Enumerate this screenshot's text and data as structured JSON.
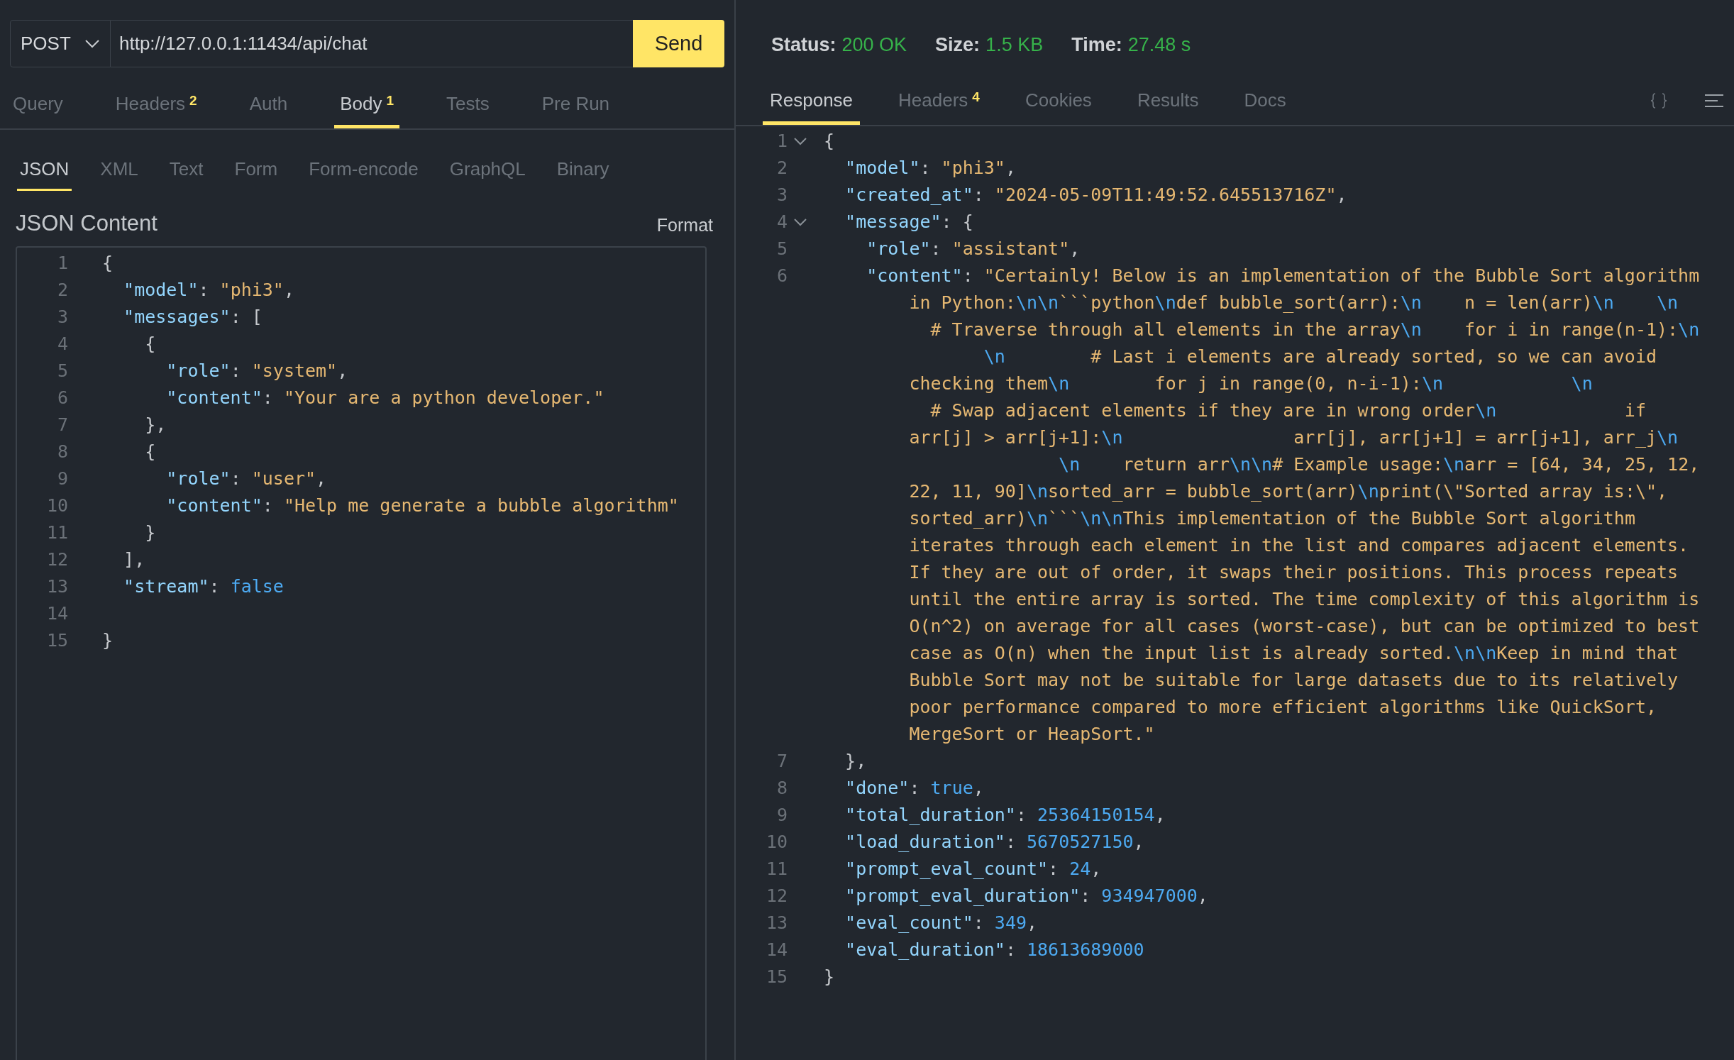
{
  "request": {
    "method": "POST",
    "url": "http://127.0.0.1:11434/api/chat",
    "send_label": "Send",
    "tabs": [
      {
        "label": "Query",
        "selected": false
      },
      {
        "label": "Headers",
        "badge": "2",
        "selected": false
      },
      {
        "label": "Auth",
        "selected": false
      },
      {
        "label": "Body",
        "badge": "1",
        "selected": true
      },
      {
        "label": "Tests",
        "selected": false
      },
      {
        "label": "Pre Run",
        "selected": false
      }
    ],
    "body_tabs": [
      {
        "label": "JSON",
        "selected": true
      },
      {
        "label": "XML",
        "selected": false
      },
      {
        "label": "Text",
        "selected": false
      },
      {
        "label": "Form",
        "selected": false
      },
      {
        "label": "Form-encode",
        "selected": false
      },
      {
        "label": "GraphQL",
        "selected": false
      },
      {
        "label": "Binary",
        "selected": false
      }
    ],
    "section_title": "JSON Content",
    "format_label": "Format",
    "lines": [
      {
        "number": "1",
        "tokens": [
          {
            "kind": "punct",
            "text": "{"
          }
        ]
      },
      {
        "number": "2",
        "tokens": [
          {
            "kind": "key",
            "text": "  \"model\""
          },
          {
            "kind": "punct",
            "text": ": "
          },
          {
            "kind": "str",
            "text": "\"phi3\""
          },
          {
            "kind": "punct",
            "text": ","
          }
        ]
      },
      {
        "number": "3",
        "tokens": [
          {
            "kind": "key",
            "text": "  \"messages\""
          },
          {
            "kind": "punct",
            "text": ": ["
          }
        ]
      },
      {
        "number": "4",
        "tokens": [
          {
            "kind": "punct",
            "text": "    {"
          }
        ]
      },
      {
        "number": "5",
        "tokens": [
          {
            "kind": "key",
            "text": "      \"role\""
          },
          {
            "kind": "punct",
            "text": ": "
          },
          {
            "kind": "str",
            "text": "\"system\""
          },
          {
            "kind": "punct",
            "text": ","
          }
        ]
      },
      {
        "number": "6",
        "tokens": [
          {
            "kind": "key",
            "text": "      \"content\""
          },
          {
            "kind": "punct",
            "text": ": "
          },
          {
            "kind": "str",
            "text": "\"Your are a python developer.\""
          }
        ]
      },
      {
        "number": "7",
        "tokens": [
          {
            "kind": "punct",
            "text": "    },"
          }
        ]
      },
      {
        "number": "8",
        "tokens": [
          {
            "kind": "punct",
            "text": "    {"
          }
        ]
      },
      {
        "number": "9",
        "tokens": [
          {
            "kind": "key",
            "text": "      \"role\""
          },
          {
            "kind": "punct",
            "text": ": "
          },
          {
            "kind": "str",
            "text": "\"user\""
          },
          {
            "kind": "punct",
            "text": ","
          }
        ]
      },
      {
        "number": "10",
        "tokens": [
          {
            "kind": "key",
            "text": "      \"content\""
          },
          {
            "kind": "punct",
            "text": ": "
          },
          {
            "kind": "str",
            "text": "\"Help me generate a bubble algorithm\""
          }
        ]
      },
      {
        "number": "11",
        "tokens": [
          {
            "kind": "punct",
            "text": "    }"
          }
        ]
      },
      {
        "number": "12",
        "tokens": [
          {
            "kind": "punct",
            "text": "  ],"
          }
        ]
      },
      {
        "number": "13",
        "tokens": [
          {
            "kind": "key",
            "text": "  \"stream\""
          },
          {
            "kind": "punct",
            "text": ": "
          },
          {
            "kind": "num",
            "text": "false"
          }
        ]
      },
      {
        "number": "14"
      },
      {
        "number": "15",
        "tokens": [
          {
            "kind": "punct",
            "text": "}"
          }
        ]
      }
    ]
  },
  "response": {
    "status": [
      {
        "label": "Status:",
        "value": "200 OK"
      },
      {
        "label": "Size:",
        "value": "1.5 KB"
      },
      {
        "label": "Time:",
        "value": "27.48 s"
      }
    ],
    "tabs": [
      {
        "label": "Response",
        "selected": true
      },
      {
        "label": "Headers",
        "badge": "4",
        "selected": false
      },
      {
        "label": "Cookies",
        "selected": false
      },
      {
        "label": "Results",
        "selected": false
      },
      {
        "label": "Docs",
        "selected": false
      }
    ],
    "lines": [
      {
        "number": "1",
        "foldable": true,
        "tokens": [
          {
            "kind": "punct",
            "text": "{"
          }
        ]
      },
      {
        "number": "2",
        "foldable": false,
        "tokens": [
          {
            "kind": "key",
            "text": "  \"model\""
          },
          {
            "kind": "punct",
            "text": ": "
          },
          {
            "kind": "str",
            "text": "\"phi3\""
          },
          {
            "kind": "punct",
            "text": ","
          }
        ]
      },
      {
        "number": "3",
        "foldable": false,
        "tokens": [
          {
            "kind": "key",
            "text": "  \"created_at\""
          },
          {
            "kind": "punct",
            "text": ": "
          },
          {
            "kind": "str",
            "text": "\"2024-05-09T11:49:52.645513716Z\""
          },
          {
            "kind": "punct",
            "text": ","
          }
        ]
      },
      {
        "number": "4",
        "foldable": true,
        "tokens": [
          {
            "kind": "key",
            "text": "  \"message\""
          },
          {
            "kind": "punct",
            "text": ": {"
          }
        ]
      },
      {
        "number": "5",
        "foldable": false,
        "tokens": [
          {
            "kind": "key",
            "text": "    \"role\""
          },
          {
            "kind": "punct",
            "text": ": "
          },
          {
            "kind": "str",
            "text": "\"assistant\""
          },
          {
            "kind": "punct",
            "text": ","
          }
        ]
      },
      {
        "number": "6",
        "foldable": false,
        "tokens": [
          {
            "kind": "key",
            "text": "    \"content\""
          },
          {
            "kind": "punct",
            "text": ": "
          },
          {
            "kind": "str",
            "text": "\"Certainly! Below is an implementation of the Bubble Sort algorithm"
          }
        ],
        "wrapped_rows": [
          [
            {
              "kind": "str",
              "text": "in Python:"
            },
            {
              "kind": "esc",
              "text": "\\n\\n"
            },
            {
              "kind": "str",
              "text": "```python"
            },
            {
              "kind": "esc",
              "text": "\\n"
            },
            {
              "kind": "str",
              "text": "def bubble_sort(arr):"
            },
            {
              "kind": "esc",
              "text": "\\n"
            },
            {
              "kind": "str",
              "text": "    n = len(arr)"
            },
            {
              "kind": "esc",
              "text": "\\n    \\n"
            }
          ],
          [
            {
              "kind": "str",
              "text": "  # Traverse through all elements in the array"
            },
            {
              "kind": "esc",
              "text": "\\n"
            },
            {
              "kind": "str",
              "text": "    for i in range(n-1):"
            },
            {
              "kind": "esc",
              "text": "\\n"
            }
          ],
          [
            {
              "kind": "esc",
              "text": "       \\n"
            },
            {
              "kind": "str",
              "text": "        # Last i elements are already sorted, so we can avoid"
            }
          ],
          [
            {
              "kind": "str",
              "text": "checking them"
            },
            {
              "kind": "esc",
              "text": "\\n"
            },
            {
              "kind": "str",
              "text": "        for j in range(0, n-i-1):"
            },
            {
              "kind": "esc",
              "text": "\\n            \\n"
            }
          ],
          [
            {
              "kind": "str",
              "text": "  # Swap adjacent elements if they are in wrong order"
            },
            {
              "kind": "esc",
              "text": "\\n"
            },
            {
              "kind": "str",
              "text": "            if"
            }
          ],
          [
            {
              "kind": "str",
              "text": "arr[j] > arr[j+1]:"
            },
            {
              "kind": "esc",
              "text": "\\n"
            },
            {
              "kind": "str",
              "text": "                arr[j], arr[j+1] = arr[j+1], arr_j"
            },
            {
              "kind": "esc",
              "text": "\\n"
            }
          ],
          [
            {
              "kind": "esc",
              "text": "              \\n"
            },
            {
              "kind": "str",
              "text": "    return arr"
            },
            {
              "kind": "esc",
              "text": "\\n\\n"
            },
            {
              "kind": "str",
              "text": "# Example usage:"
            },
            {
              "kind": "esc",
              "text": "\\n"
            },
            {
              "kind": "str",
              "text": "arr = [64, 34, 25, 12,"
            }
          ],
          [
            {
              "kind": "str",
              "text": "22, 11, 90]"
            },
            {
              "kind": "esc",
              "text": "\\n"
            },
            {
              "kind": "str",
              "text": "sorted_arr = bubble_sort(arr)"
            },
            {
              "kind": "esc",
              "text": "\\n"
            },
            {
              "kind": "str",
              "text": "print(\\\"Sorted array is:\\\","
            }
          ],
          [
            {
              "kind": "str",
              "text": "sorted_arr)"
            },
            {
              "kind": "esc",
              "text": "\\n"
            },
            {
              "kind": "str",
              "text": "```"
            },
            {
              "kind": "esc",
              "text": "\\n\\n"
            },
            {
              "kind": "str",
              "text": "This implementation of the Bubble Sort algorithm"
            }
          ],
          [
            {
              "kind": "str",
              "text": "iterates through each element in the list and compares adjacent elements."
            }
          ],
          [
            {
              "kind": "str",
              "text": "If they are out of order, it swaps their positions. This process repeats"
            }
          ],
          [
            {
              "kind": "str",
              "text": "until the entire array is sorted. The time complexity of this algorithm is"
            }
          ],
          [
            {
              "kind": "str",
              "text": "O(n^2) on average for all cases (worst-case), but can be optimized to best"
            }
          ],
          [
            {
              "kind": "str",
              "text": "case as O(n) when the input list is already sorted."
            },
            {
              "kind": "esc",
              "text": "\\n\\n"
            },
            {
              "kind": "str",
              "text": "Keep in mind that"
            }
          ],
          [
            {
              "kind": "str",
              "text": "Bubble Sort may not be suitable for large datasets due to its relatively"
            }
          ],
          [
            {
              "kind": "str",
              "text": "poor performance compared to more efficient algorithms like QuickSort,"
            }
          ],
          [
            {
              "kind": "str",
              "text": "MergeSort or HeapSort.\""
            }
          ]
        ]
      },
      {
        "number": "7",
        "foldable": false,
        "tokens": [
          {
            "kind": "punct",
            "text": "  },"
          }
        ]
      },
      {
        "number": "8",
        "foldable": false,
        "tokens": [
          {
            "kind": "key",
            "text": "  \"done\""
          },
          {
            "kind": "punct",
            "text": ": "
          },
          {
            "kind": "num",
            "text": "true"
          },
          {
            "kind": "punct",
            "text": ","
          }
        ]
      },
      {
        "number": "9",
        "foldable": false,
        "tokens": [
          {
            "kind": "key",
            "text": "  \"total_duration\""
          },
          {
            "kind": "punct",
            "text": ": "
          },
          {
            "kind": "num",
            "text": "25364150154"
          },
          {
            "kind": "punct",
            "text": ","
          }
        ]
      },
      {
        "number": "10",
        "foldable": false,
        "tokens": [
          {
            "kind": "key",
            "text": "  \"load_duration\""
          },
          {
            "kind": "punct",
            "text": ": "
          },
          {
            "kind": "num",
            "text": "5670527150"
          },
          {
            "kind": "punct",
            "text": ","
          }
        ]
      },
      {
        "number": "11",
        "foldable": false,
        "tokens": [
          {
            "kind": "key",
            "text": "  \"prompt_eval_count\""
          },
          {
            "kind": "punct",
            "text": ": "
          },
          {
            "kind": "num",
            "text": "24"
          },
          {
            "kind": "punct",
            "text": ","
          }
        ]
      },
      {
        "number": "12",
        "foldable": false,
        "tokens": [
          {
            "kind": "key",
            "text": "  \"prompt_eval_duration\""
          },
          {
            "kind": "punct",
            "text": ": "
          },
          {
            "kind": "num",
            "text": "934947000"
          },
          {
            "kind": "punct",
            "text": ","
          }
        ]
      },
      {
        "number": "13",
        "foldable": false,
        "tokens": [
          {
            "kind": "key",
            "text": "  \"eval_count\""
          },
          {
            "kind": "punct",
            "text": ": "
          },
          {
            "kind": "num",
            "text": "349"
          },
          {
            "kind": "punct",
            "text": ","
          }
        ]
      },
      {
        "number": "14",
        "foldable": false,
        "tokens": [
          {
            "kind": "key",
            "text": "  \"eval_duration\""
          },
          {
            "kind": "punct",
            "text": ": "
          },
          {
            "kind": "num",
            "text": "18613689000"
          }
        ]
      },
      {
        "number": "15",
        "foldable": false,
        "tokens": [
          {
            "kind": "punct",
            "text": "}"
          }
        ]
      }
    ]
  }
}
